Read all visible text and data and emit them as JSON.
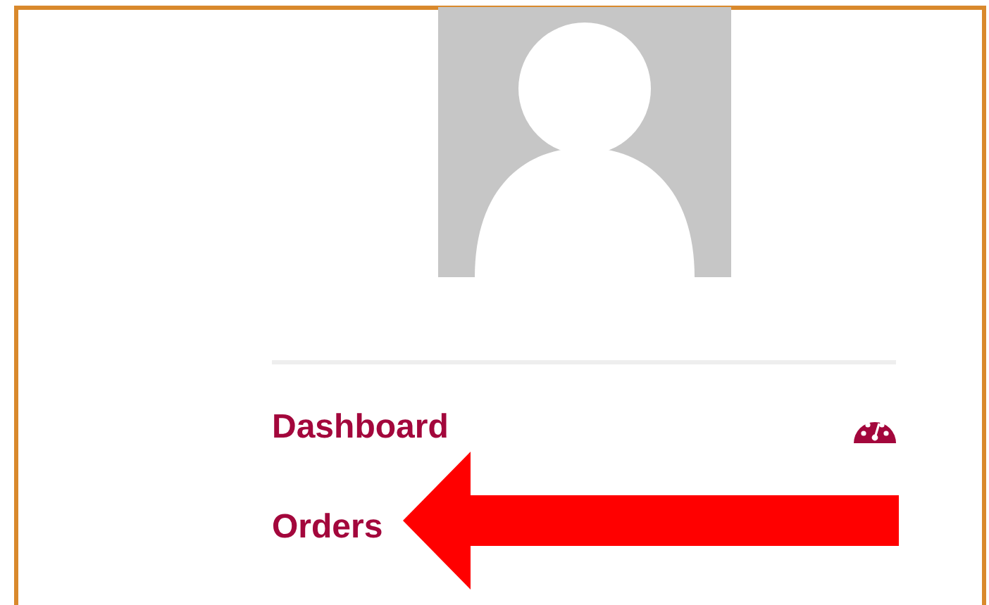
{
  "menu": [
    {
      "label": "Dashboard"
    },
    {
      "label": "Orders"
    }
  ]
}
